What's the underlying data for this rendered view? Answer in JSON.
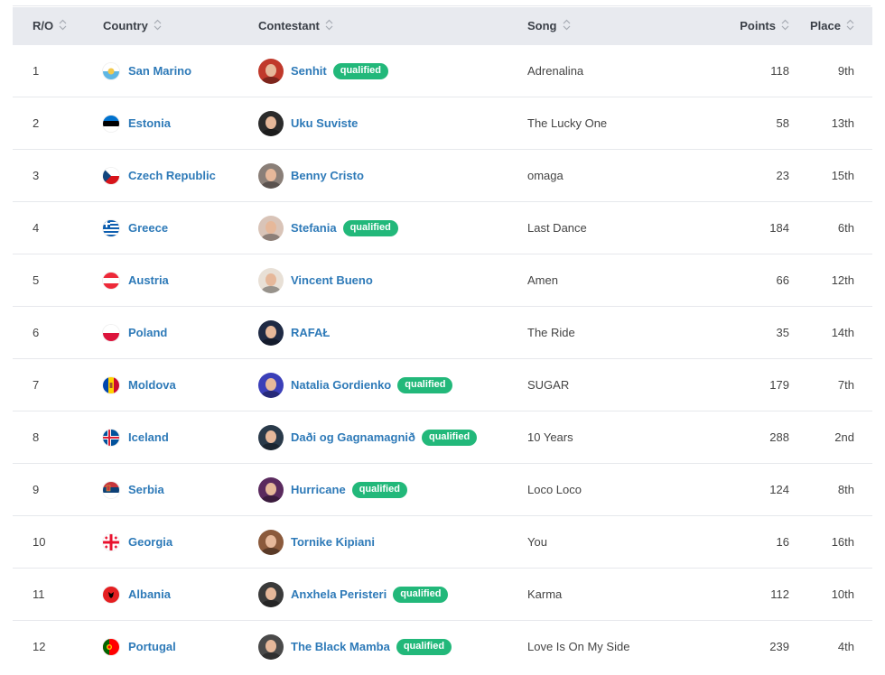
{
  "columns": {
    "ro": "R/O",
    "country": "Country",
    "contestant": "Contestant",
    "song": "Song",
    "points": "Points",
    "place": "Place"
  },
  "badge_label": "qualified",
  "rows": [
    {
      "ro": "1",
      "country": "San Marino",
      "flag": "san-marino",
      "contestant": "Senhit",
      "qualified": true,
      "song": "Adrenalina",
      "points": "118",
      "place": "9th",
      "avatar": "#c0392b"
    },
    {
      "ro": "2",
      "country": "Estonia",
      "flag": "estonia",
      "contestant": "Uku Suviste",
      "qualified": false,
      "song": "The Lucky One",
      "points": "58",
      "place": "13th",
      "avatar": "#2b2b2b"
    },
    {
      "ro": "3",
      "country": "Czech Republic",
      "flag": "czech-republic",
      "contestant": "Benny Cristo",
      "qualified": false,
      "song": "omaga",
      "points": "23",
      "place": "15th",
      "avatar": "#8a7f78"
    },
    {
      "ro": "4",
      "country": "Greece",
      "flag": "greece",
      "contestant": "Stefania",
      "qualified": true,
      "song": "Last Dance",
      "points": "184",
      "place": "6th",
      "avatar": "#d9c4b8"
    },
    {
      "ro": "5",
      "country": "Austria",
      "flag": "austria",
      "contestant": "Vincent Bueno",
      "qualified": false,
      "song": "Amen",
      "points": "66",
      "place": "12th",
      "avatar": "#e8e0d6"
    },
    {
      "ro": "6",
      "country": "Poland",
      "flag": "poland",
      "contestant": "RAFAŁ",
      "qualified": false,
      "song": "The Ride",
      "points": "35",
      "place": "14th",
      "avatar": "#1f2a44"
    },
    {
      "ro": "7",
      "country": "Moldova",
      "flag": "moldova",
      "contestant": "Natalia Gordienko",
      "qualified": true,
      "song": "SUGAR",
      "points": "179",
      "place": "7th",
      "avatar": "#3b3fb8"
    },
    {
      "ro": "8",
      "country": "Iceland",
      "flag": "iceland",
      "contestant": "Daði og Gagnamagnið",
      "qualified": true,
      "song": "10 Years",
      "points": "288",
      "place": "2nd",
      "avatar": "#2a3a4a"
    },
    {
      "ro": "9",
      "country": "Serbia",
      "flag": "serbia",
      "contestant": "Hurricane",
      "qualified": true,
      "song": "Loco Loco",
      "points": "124",
      "place": "8th",
      "avatar": "#5a2a5e"
    },
    {
      "ro": "10",
      "country": "Georgia",
      "flag": "georgia",
      "contestant": "Tornike Kipiani",
      "qualified": false,
      "song": "You",
      "points": "16",
      "place": "16th",
      "avatar": "#8b5a3c"
    },
    {
      "ro": "11",
      "country": "Albania",
      "flag": "albania",
      "contestant": "Anxhela Peristeri",
      "qualified": true,
      "song": "Karma",
      "points": "112",
      "place": "10th",
      "avatar": "#3a3a3a"
    },
    {
      "ro": "12",
      "country": "Portugal",
      "flag": "portugal",
      "contestant": "The Black Mamba",
      "qualified": true,
      "song": "Love Is On My Side",
      "points": "239",
      "place": "4th",
      "avatar": "#4a4a4a"
    }
  ]
}
